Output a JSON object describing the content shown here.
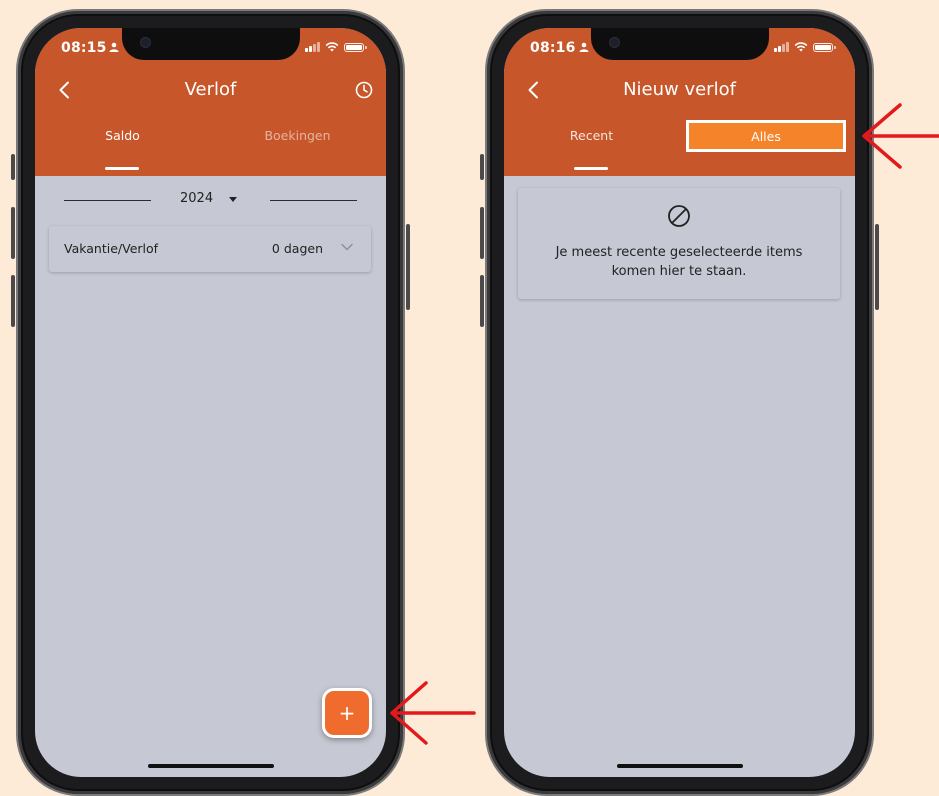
{
  "colors": {
    "background": "#fdebd8",
    "appbar": "#c7562a",
    "screen": "#c6c8d3",
    "accent_orange": "#f06c2e",
    "highlight_tab": "#f5832a",
    "annotation_arrow": "#e3191c"
  },
  "left_phone": {
    "status": {
      "time": "08:15"
    },
    "header": {
      "title": "Verlof",
      "back_icon": "chevron-left-icon",
      "history_icon": "clock-icon"
    },
    "tabs": [
      {
        "label": "Saldo",
        "selected": true
      },
      {
        "label": "Boekingen",
        "selected": false
      }
    ],
    "year_selector": {
      "value": "2024"
    },
    "balance_card": {
      "label": "Vakantie/Verlof",
      "value": "0 dagen",
      "icon": "chevron-down-icon"
    },
    "fab": {
      "label": "+"
    }
  },
  "right_phone": {
    "status": {
      "time": "08:16"
    },
    "header": {
      "title": "Nieuw verlof",
      "back_icon": "chevron-left-icon"
    },
    "tabs": [
      {
        "label": "Recent",
        "selected": true
      },
      {
        "label": "Alles",
        "selected": false,
        "highlighted": true
      }
    ],
    "empty_state": {
      "icon": "block-icon",
      "message": "Je meest recente geselecteerde items komen hier te staan."
    }
  }
}
